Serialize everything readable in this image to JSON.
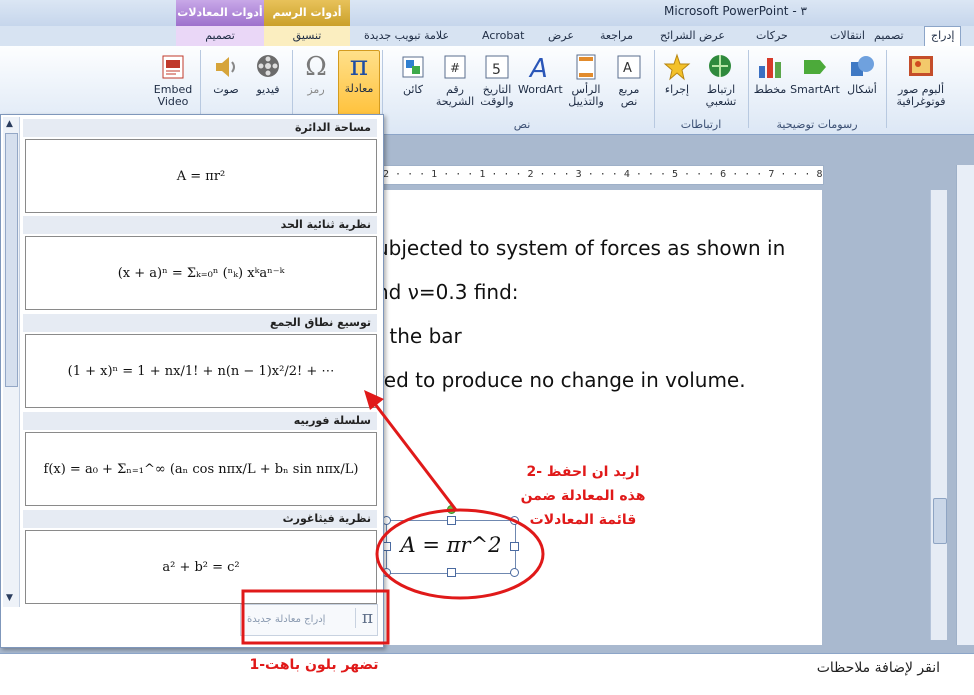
{
  "window": {
    "title": "Microsoft PowerPoint - ٣"
  },
  "context_tabs": {
    "equation_tools": "أدوات المعادلات",
    "drawing_tools": "أدوات الرسم"
  },
  "tabs": [
    "إدراج",
    "تصميم",
    "انتقالات",
    "حركات",
    "عرض الشرائح",
    "مراجعة",
    "عرض",
    "Acrobat",
    "علامة تبويب جديدة",
    "تنسيق",
    "تصميم"
  ],
  "ribbon": {
    "buttons": {
      "album": "ألبوم صور فوتوغرافية",
      "shapes": "أشكال",
      "smartart": "SmartArt",
      "chart": "مخطط",
      "hyperlink": "ارتباط تشعبي",
      "action": "إجراء",
      "textbox": "مربع نص",
      "header_footer": "الرأس والتذييل",
      "wordart": "WordArt",
      "date_time": "التاريخ والوقت",
      "slide_number": "رقم الشريحة",
      "object": "كائن",
      "equation": "معادلة",
      "symbol": "رمز",
      "video": "فيديو",
      "audio": "صوت",
      "embed_video": "Embed Video"
    },
    "groups": {
      "illustrations": "رسومات توضيحية",
      "links": "ارتباطات",
      "text": "نص"
    }
  },
  "ruler_text": "2 · · · 1 · · · 1 · · · 2 · · · 3 · · · 4 · · · 5 · · · 6 · · · 7 · · · 8 · · · 9 ·",
  "gallery": {
    "items": [
      {
        "title": "مساحة الدائرة",
        "formula": "A = πr²"
      },
      {
        "title": "نظرية ثنائية الحد",
        "formula": "(x + a)ⁿ = Σₖ₌₀ⁿ (ⁿₖ) xᵏaⁿ⁻ᵏ"
      },
      {
        "title": "توسيع نطاق الجمع",
        "formula": "(1 + x)ⁿ = 1 + nx/1! + n(n − 1)x²/2! + ⋯"
      },
      {
        "title": "سلسلة فورييه",
        "formula": "f(x) = a₀ + Σₙ₌₁^∞ (aₙ cos nπx/L + bₙ sin nπx/L)"
      },
      {
        "title": "نظرية فيثاغورث",
        "formula": "a² + b² = c²"
      }
    ],
    "insert_new": "إدراج معادلة جديدة"
  },
  "slide": {
    "lines": [
      "ubjected to system of forces as shown in",
      "nd ν=0.3 find:",
      "f the bar",
      "red to produce no change in volume."
    ],
    "equation": "A = πr^2"
  },
  "annotations": {
    "note1": "1-تضهر بلون باهت",
    "note2": [
      "2- اريد ان احفظ",
      "هذه المعادلة ضمن",
      "قائمة المعادلات"
    ]
  },
  "notes_placeholder": "انقر لإضافة ملاحظات",
  "colors": {
    "annotation": "#e01919",
    "selected_button": "#ffc13a"
  }
}
